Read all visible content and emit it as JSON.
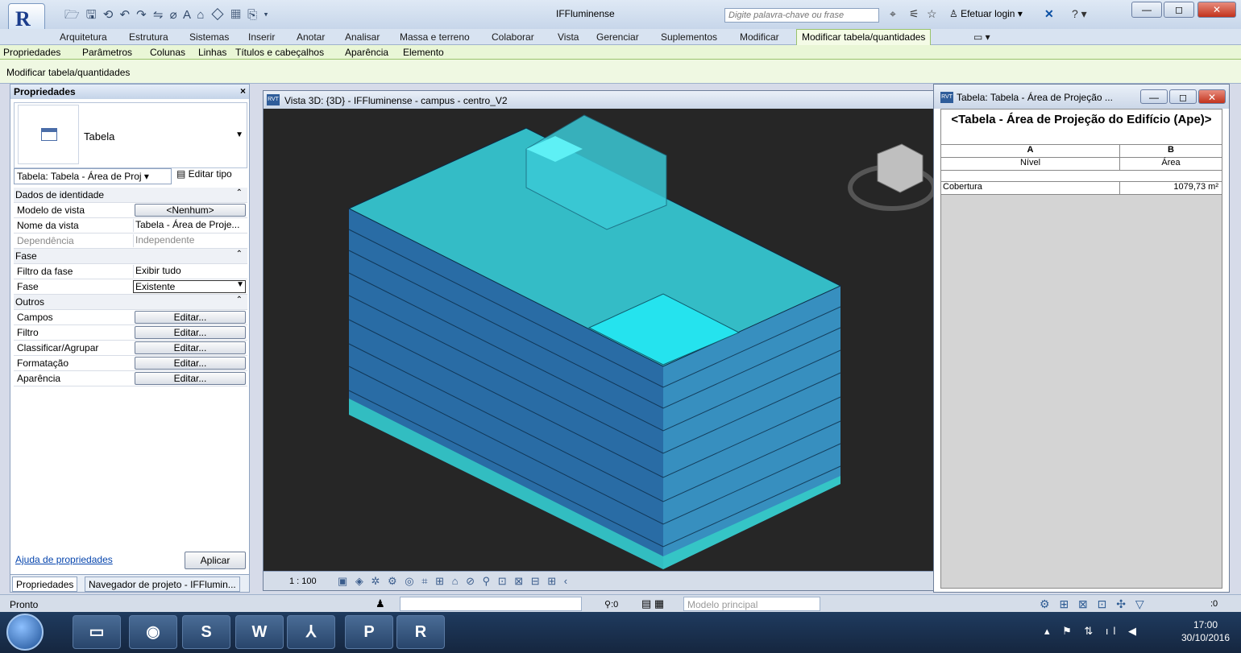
{
  "app": {
    "title": "IFFluminense",
    "logo_letter": "R",
    "search_placeholder": "Digite palavra-chave ou frase",
    "login_label": "Efetuar login",
    "help_icon": "?"
  },
  "ribbon": {
    "tabs": [
      "Arquitetura",
      "Estrutura",
      "Sistemas",
      "Inserir",
      "Anotar",
      "Analisar",
      "Massa e terreno",
      "Colaborar",
      "Vista",
      "Gerenciar",
      "Suplementos",
      "Modificar",
      "Modificar tabela/quantidades"
    ],
    "active_tab": "Modificar tabela/quantidades",
    "context_tabs": [
      "Propriedades",
      "Parâmetros",
      "Colunas",
      "Linhas",
      "Títulos e cabeçalhos",
      "Aparência",
      "Elemento"
    ],
    "context_panel_label": "Modificar tabela/quantidades"
  },
  "properties": {
    "header": "Propriedades",
    "close": "×",
    "type_name": "Tabela",
    "type_selector": "Tabela: Tabela - Área de Proj",
    "edit_type": "Editar tipo",
    "sections": {
      "identity": "Dados de identidade",
      "phase": "Fase",
      "other": "Outros"
    },
    "rows": {
      "view_template": {
        "k": "Modelo de vista",
        "v": "<Nenhum>"
      },
      "view_name": {
        "k": "Nome da vista",
        "v": "Tabela - Área de Proje..."
      },
      "dependency": {
        "k": "Dependência",
        "v": "Independente"
      },
      "phase_filter": {
        "k": "Filtro da fase",
        "v": "Exibir tudo"
      },
      "phase": {
        "k": "Fase",
        "v": "Existente"
      },
      "fields": {
        "k": "Campos",
        "v": "Editar..."
      },
      "filter": {
        "k": "Filtro",
        "v": "Editar..."
      },
      "sort": {
        "k": "Classificar/Agrupar",
        "v": "Editar..."
      },
      "formatting": {
        "k": "Formatação",
        "v": "Editar..."
      },
      "appearance": {
        "k": "Aparência",
        "v": "Editar..."
      }
    },
    "help_link": "Ajuda de propriedades",
    "apply": "Aplicar",
    "tabs": [
      "Propriedades",
      "Navegador de projeto - IFFlumin..."
    ]
  },
  "view3d": {
    "title": "Vista 3D: {3D} - IFFluminense - campus - centro_V2",
    "scale": "1 : 100"
  },
  "schedule": {
    "window_title": "Tabela: Tabela - Área de Projeção ...",
    "title": "<Tabela - Área de Projeção do Edifício (Ape)>",
    "col_letters": [
      "A",
      "B"
    ],
    "col_headers": [
      "Nível",
      "Área"
    ],
    "rows": [
      {
        "level": "Cobertura",
        "area": "1079,73 m²"
      }
    ]
  },
  "status": {
    "text": "Pronto",
    "worksets": ":0",
    "model": "Modelo principal",
    "filter_count": ":0"
  },
  "taskbar": {
    "time": "17:00",
    "date": "30/10/2016"
  },
  "colors": {
    "building_top": "#2ec9d0",
    "building_floor": "#3a88c4",
    "viewport_bg": "#262626",
    "context_tab_green": "#e9f6d6"
  }
}
